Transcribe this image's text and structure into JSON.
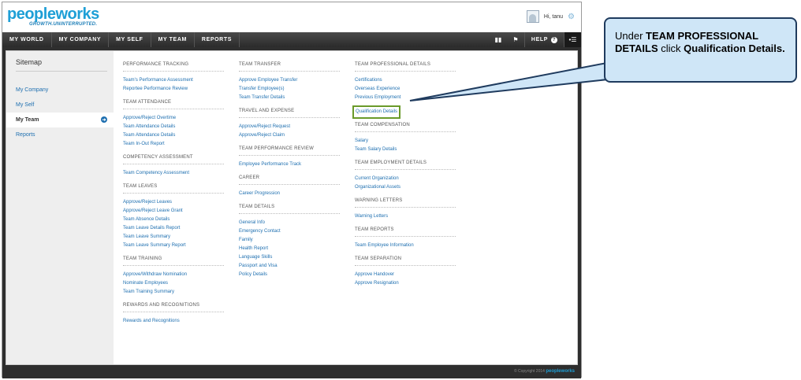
{
  "header": {
    "logo_main": "peopleworks",
    "logo_tagline": "GROWTH.UNINTERRUPTED.",
    "greeting": "Hi, tanu"
  },
  "nav": {
    "items": [
      "MY WORLD",
      "MY COMPANY",
      "MY SELF",
      "MY TEAM",
      "REPORTS"
    ],
    "help_label": "HELP"
  },
  "sidebar": {
    "title": "Sitemap",
    "items": [
      {
        "label": "My Company",
        "active": false
      },
      {
        "label": "My Self",
        "active": false
      },
      {
        "label": "My Team",
        "active": true
      },
      {
        "label": "Reports",
        "active": false
      }
    ]
  },
  "columns": [
    {
      "sections": [
        {
          "title": "PERFORMANCE TRACKING",
          "links": [
            "Team's Performance Assessment",
            "Reportee Performance Review"
          ]
        },
        {
          "title": "TEAM ATTENDANCE",
          "links": [
            "Approve/Reject Overtime",
            "Team Attendance Details",
            "Team Attendance Details",
            "Team In-Out Report"
          ]
        },
        {
          "title": "COMPETENCY ASSESSMENT",
          "links": [
            "Team Competency Assessment"
          ]
        },
        {
          "title": "TEAM LEAVES",
          "links": [
            "Approve/Reject Leaves",
            "Approve/Reject Leave Grant",
            "Team Absence Details",
            "Team Leave Details Report",
            "Team Leave Summary",
            "Team Leave Summary Report"
          ]
        },
        {
          "title": "TEAM TRAINING",
          "links": [
            "Approve/Withdraw Nomination",
            "Nominate Employees",
            "Team Training Summary"
          ]
        },
        {
          "title": "REWARDS AND RECOGNITIONS",
          "links": [
            "Rewards and Recognitions"
          ]
        }
      ]
    },
    {
      "sections": [
        {
          "title": "TEAM TRANSFER",
          "links": [
            "Approve Employee Transfer",
            "Transfer Employee(s)",
            "Team Transfer Details"
          ]
        },
        {
          "title": "TRAVEL AND EXPENSE",
          "links": [
            "Approve/Reject Request",
            "Approve/Reject Claim"
          ]
        },
        {
          "title": "TEAM PERFORMANCE REVIEW",
          "links": [
            "Employee Performance Track"
          ]
        },
        {
          "title": "CAREER",
          "links": [
            "Career Progression"
          ]
        },
        {
          "title": "TEAM DETAILS",
          "links": [
            "General Info",
            "Emergency Contact",
            "Family",
            "Health Report",
            "Language Skills",
            "Passport and Visa",
            "Policy Details"
          ]
        }
      ]
    },
    {
      "sections": [
        {
          "title": "TEAM PROFESSIONAL DETAILS",
          "links": [
            "Certifications",
            "Overseas Experience",
            "Previous Employment",
            "Qualification Details"
          ]
        },
        {
          "title": "TEAM COMPENSATION",
          "links": [
            "Salary",
            "Team Salary Details"
          ]
        },
        {
          "title": "TEAM EMPLOYMENT DETAILS",
          "links": [
            "Current Organization",
            "Organizational Assets"
          ]
        },
        {
          "title": "WARNING LETTERS",
          "links": [
            "Warning Letters"
          ]
        },
        {
          "title": "TEAM REPORTS",
          "links": [
            "Team Employee Information"
          ]
        },
        {
          "title": "TEAM SEPARATION",
          "links": [
            "Approve Handover",
            "Approve Resignation"
          ]
        }
      ]
    }
  ],
  "highlight_link": "Qualification Details",
  "footer": {
    "copyright": "© Copyright 2014",
    "brand": "peopleworks"
  },
  "callout": {
    "pre": "Under ",
    "bold1": "TEAM PROFESSIONAL DETAILS",
    "mid": " click ",
    "bold2": "Qualification Details."
  },
  "colors": {
    "accent": "#1e6fb0",
    "highlight": "#6a9a2a",
    "callout_bg": "#cfe6f7"
  }
}
